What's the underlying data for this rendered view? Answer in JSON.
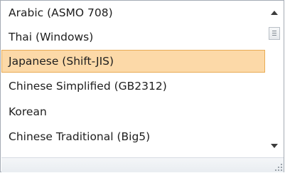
{
  "encoding_list": {
    "items": [
      {
        "label": "Arabic (ASMO 708)",
        "selected": false
      },
      {
        "label": "Thai (Windows)",
        "selected": false
      },
      {
        "label": "Japanese (Shift-JIS)",
        "selected": true
      },
      {
        "label": "Chinese Simplified (GB2312)",
        "selected": false
      },
      {
        "label": "Korean",
        "selected": false
      },
      {
        "label": "Chinese Traditional (Big5)",
        "selected": false
      }
    ],
    "selected_index": 2
  },
  "scrollbar": {
    "up_icon": "arrow-up",
    "down_icon": "arrow-down"
  },
  "colors": {
    "selection_fill": "#fcd9a8",
    "selection_border": "#e9ac55",
    "border": "#a5acb5"
  }
}
